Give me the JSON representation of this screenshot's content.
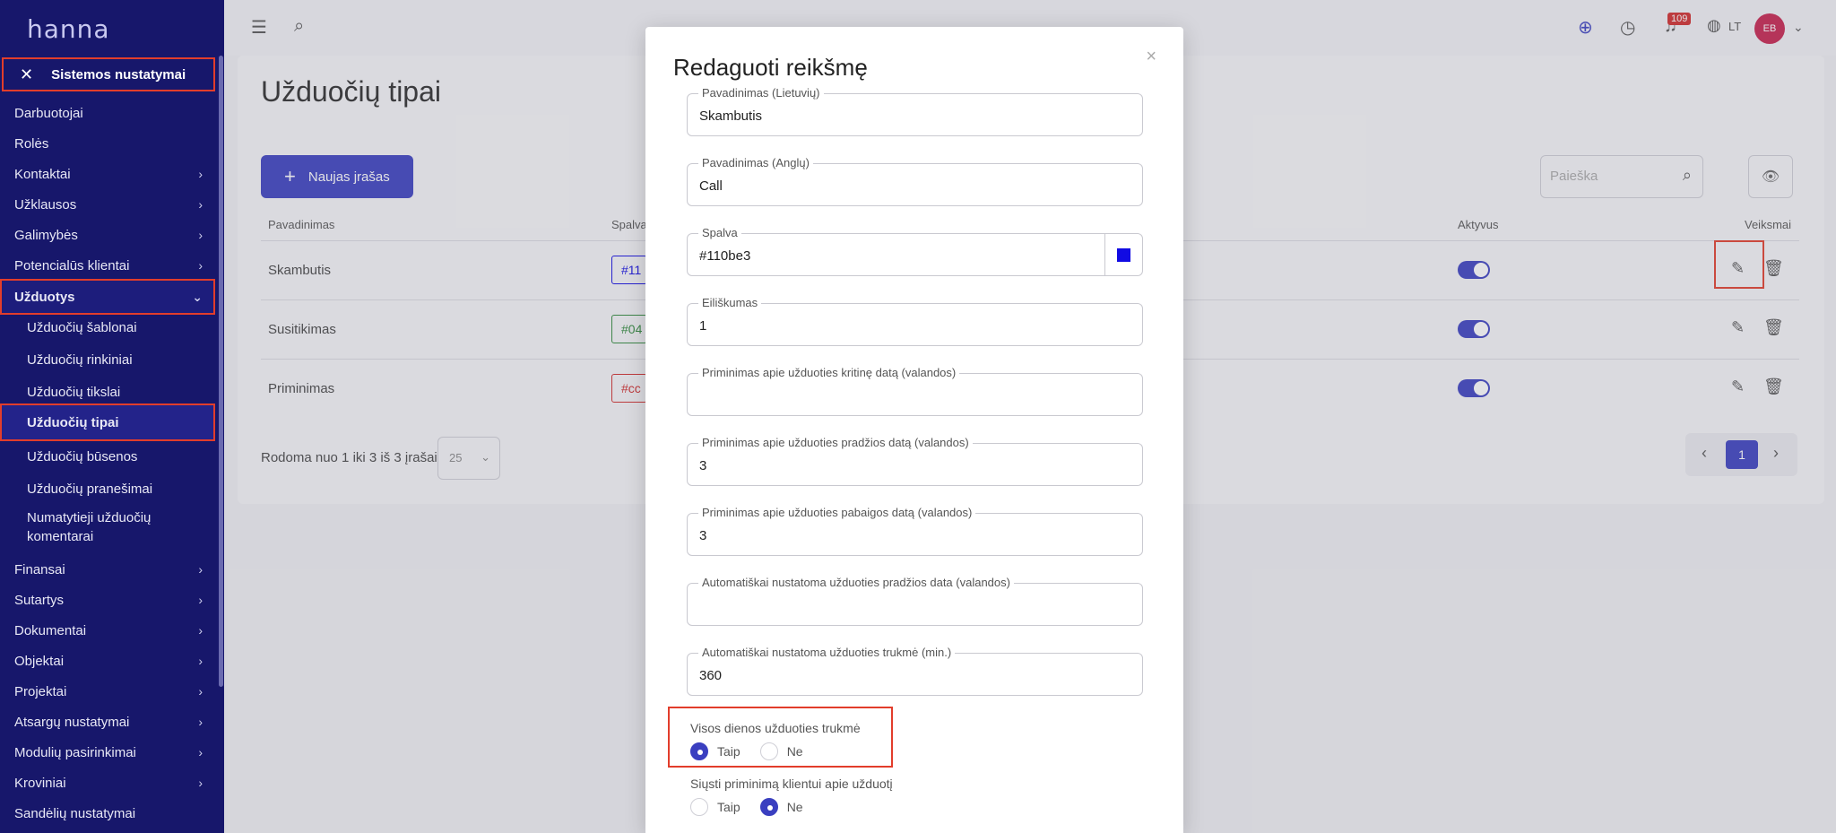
{
  "sidebar": {
    "logo": "hanna",
    "section_title": "Sistemos nustatymai",
    "items": [
      {
        "label": "Darbuotojai",
        "chevron": false
      },
      {
        "label": "Rolės",
        "chevron": false
      },
      {
        "label": "Kontaktai",
        "chevron": true
      },
      {
        "label": "Užklausos",
        "chevron": true
      },
      {
        "label": "Galimybės",
        "chevron": true
      },
      {
        "label": "Potencialūs klientai",
        "chevron": true
      },
      {
        "label": "Užduotys",
        "chevron": true
      },
      {
        "label": "Užduočių šablonai",
        "chevron": false
      },
      {
        "label": "Užduočių rinkiniai",
        "chevron": false
      },
      {
        "label": "Užduočių tikslai",
        "chevron": false
      },
      {
        "label": "Užduočių tipai",
        "chevron": false
      },
      {
        "label": "Užduočių būsenos",
        "chevron": false
      },
      {
        "label": "Užduočių pranešimai",
        "chevron": false
      },
      {
        "label": "Numatytieji užduočių",
        "chevron": false
      },
      {
        "label": "komentarai",
        "chevron": false
      },
      {
        "label": "Finansai",
        "chevron": true
      },
      {
        "label": "Sutartys",
        "chevron": true
      },
      {
        "label": "Dokumentai",
        "chevron": true
      },
      {
        "label": "Objektai",
        "chevron": true
      },
      {
        "label": "Projektai",
        "chevron": true
      },
      {
        "label": "Atsargų nustatymai",
        "chevron": true
      },
      {
        "label": "Modulių pasirinkimai",
        "chevron": true
      },
      {
        "label": "Kroviniai",
        "chevron": true
      },
      {
        "label": "Sandėlių nustatymai",
        "chevron": false
      }
    ]
  },
  "topbar": {
    "notifications_count": "109",
    "language": "LT",
    "avatar_initials": "EB"
  },
  "page": {
    "title": "Užduočių tipai",
    "new_button": "Naujas jrašas",
    "search_placeholder": "Paieška",
    "columns": {
      "name": "Pavadinimas",
      "color": "Spalva",
      "active": "Aktyvus",
      "actions": "Veiksmai"
    },
    "rows": [
      {
        "name": "Skambutis",
        "color_text": "#11",
        "color": "#110be3"
      },
      {
        "name": "Susitikimas",
        "color_text": "#04",
        "color": "#2f8a3a"
      },
      {
        "name": "Priminimas",
        "color_text": "#cc",
        "color": "#d12b2b"
      }
    ],
    "footer_text": "Rodoma nuo 1 iki 3 iš 3 įrašai",
    "per_page": "25",
    "current_page": "1"
  },
  "modal": {
    "title": "Redaguoti reikšmę",
    "close": "×",
    "fields": [
      {
        "label": "Pavadinimas (Lietuvių)",
        "value": "Skambutis"
      },
      {
        "label": "Pavadinimas (Anglų)",
        "value": "Call"
      },
      {
        "label": "Spalva",
        "value": "#110be3"
      },
      {
        "label": "Eiliškumas",
        "value": "1"
      },
      {
        "label": "Priminimas apie užduoties kritinę datą (valandos)",
        "value": ""
      },
      {
        "label": "Priminimas apie užduoties pradžios datą (valandos)",
        "value": "3"
      },
      {
        "label": "Priminimas apie užduoties pabaigos datą (valandos)",
        "value": "3"
      },
      {
        "label": "Automatiškai nustatoma užduoties pradžios data (valandos)",
        "value": ""
      },
      {
        "label": "Automatiškai nustatoma užduoties trukmė (min.)",
        "value": "360"
      }
    ],
    "radio_groups": [
      {
        "title": "Visos dienos užduoties trukmė",
        "yes": "Taip",
        "no": "Ne",
        "selected": "yes"
      },
      {
        "title": "Siųsti priminimą klientui apie užduotį",
        "yes": "Taip",
        "no": "Ne",
        "selected": "no"
      }
    ]
  }
}
